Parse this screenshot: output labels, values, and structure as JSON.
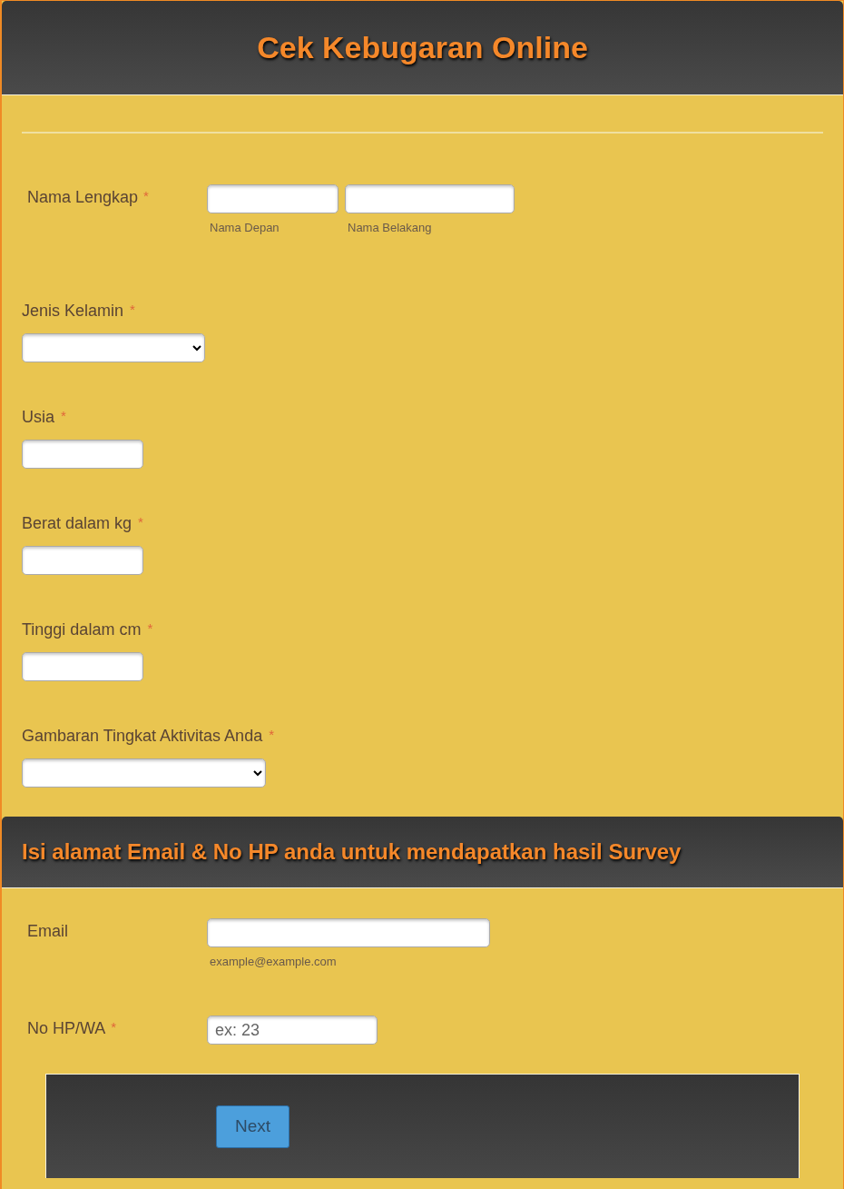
{
  "title": "Cek Kebugaran Online",
  "fields": [
    {
      "kind": "name",
      "label": "Nama Lengkap",
      "required_mark": "*",
      "sublabels": [
        "Nama Depan",
        "Nama Belakang"
      ]
    },
    {
      "kind": "select",
      "label": "Jenis Kelamin",
      "required_mark": "*"
    },
    {
      "kind": "text",
      "label": "Usia",
      "required_mark": "*"
    },
    {
      "kind": "text",
      "label": "Berat dalam kg",
      "required_mark": "*"
    },
    {
      "kind": "text",
      "label": "Tinggi dalam cm",
      "required_mark": "*"
    },
    {
      "kind": "wide_select",
      "label": "Gambaran Tingkat Aktivitas Anda",
      "required_mark": "*"
    }
  ],
  "section_title": "Isi alamat Email & No HP anda untuk mendapatkan hasil Survey",
  "contact_fields": [
    {
      "kind": "email",
      "label": "Email",
      "sublabel": "example@example.com"
    },
    {
      "kind": "phone",
      "label": "No HP/WA",
      "required_mark": "*",
      "placeholder": "ex: 23"
    }
  ],
  "button": "Next"
}
